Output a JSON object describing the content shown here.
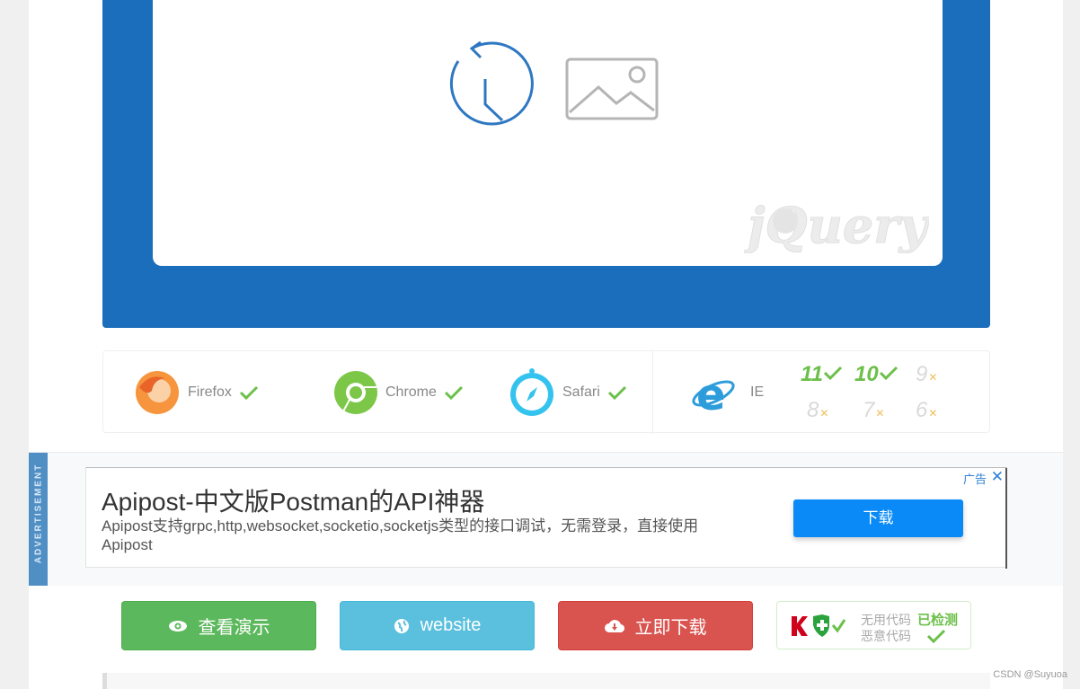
{
  "browsers": [
    {
      "name": "Firefox"
    },
    {
      "name": "Chrome"
    },
    {
      "name": "Safari"
    },
    {
      "name": "IE"
    }
  ],
  "ie_versions": [
    {
      "v": "11",
      "supported": true
    },
    {
      "v": "10",
      "supported": true
    },
    {
      "v": "9",
      "supported": false
    },
    {
      "v": "8",
      "supported": false
    },
    {
      "v": "7",
      "supported": false
    },
    {
      "v": "6",
      "supported": false
    }
  ],
  "ad": {
    "strip_label": "ADVERTISEMENT",
    "title": "Apipost-中文版Postman的API神器",
    "description": "Apipost支持grpc,http,websocket,socketio,socketjs类型的接口调试，无需登录，直接使用Apipost",
    "button": "下载",
    "tag": "广告"
  },
  "actions": {
    "demo_label": "查看演示",
    "website_label": "website",
    "download_label": "立即下载"
  },
  "safety": {
    "line1": "无用代码",
    "line2": "恶意代码",
    "status": "已检测"
  },
  "credit": "CSDN @Suyuoa",
  "colors": {
    "frame_blue": "#1b6ebc",
    "demo_green": "#5cb85c",
    "web_cyan": "#5bc0de",
    "download_red": "#d9534f",
    "ad_button": "#0a8af7"
  },
  "icons": [
    "clock-history-icon",
    "image-placeholder-icon",
    "firefox-icon",
    "chrome-icon",
    "safari-icon",
    "ie-icon",
    "eye-icon",
    "globe-icon",
    "cloud-download-icon",
    "shield-icon"
  ]
}
